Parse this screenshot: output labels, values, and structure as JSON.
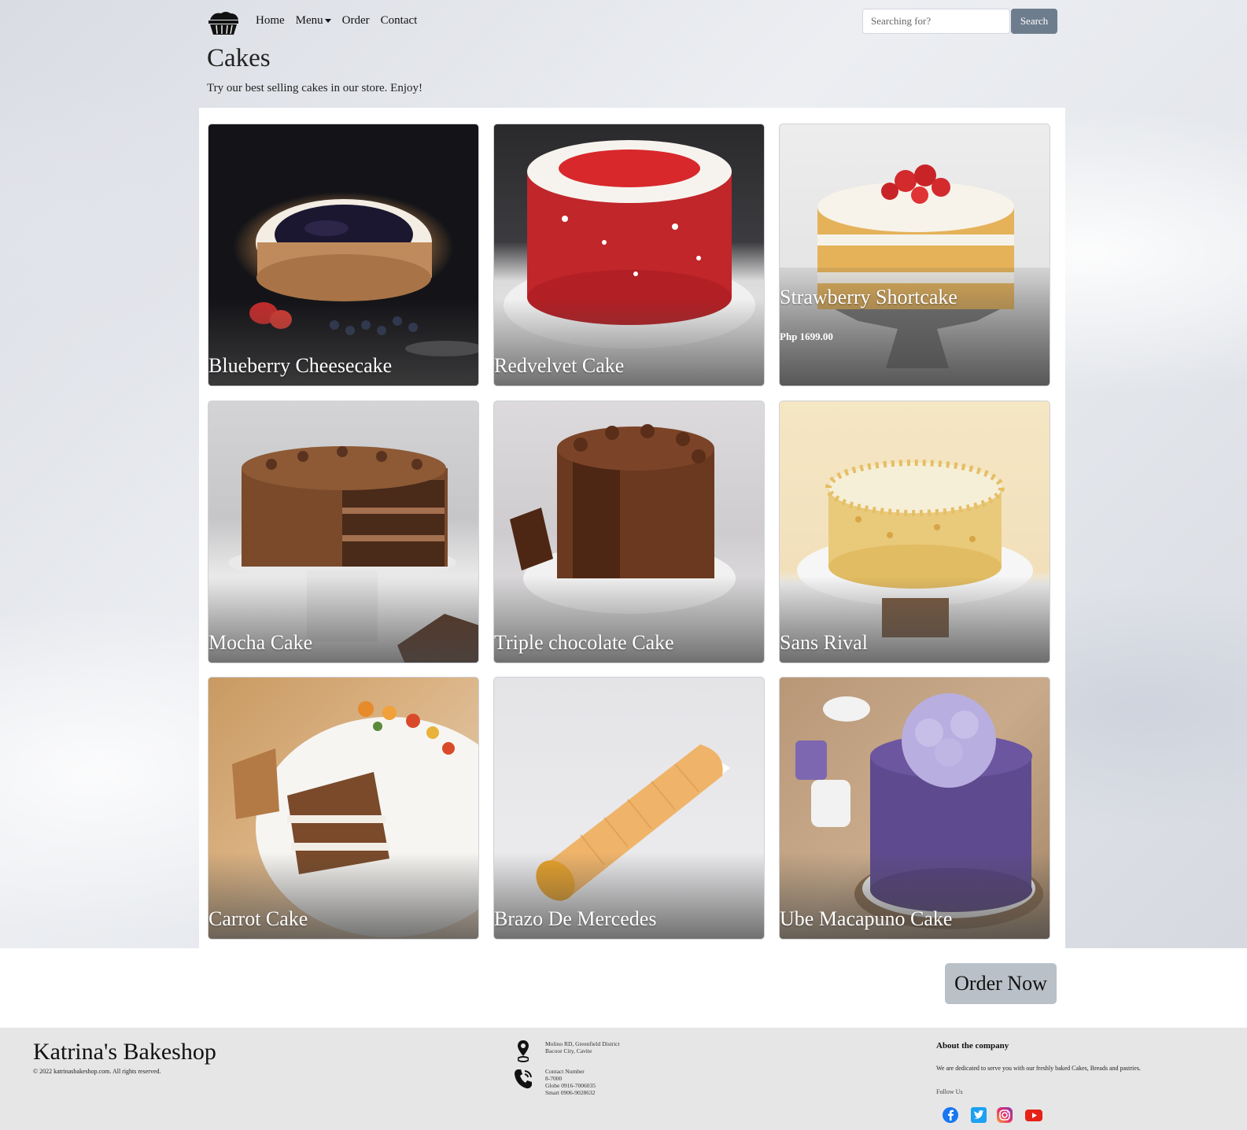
{
  "nav": {
    "logo_icon": "cake-icon",
    "links": [
      "Home",
      "Menu",
      "Order",
      "Contact"
    ],
    "search_placeholder": "Searching for?",
    "search_button": "Search"
  },
  "header": {
    "title": "Cakes",
    "subtitle": "Try our best selling cakes in our store. Enjoy!"
  },
  "products": [
    {
      "name": "Blueberry Cheesecake"
    },
    {
      "name": "Redvelvet Cake"
    },
    {
      "name": "Strawberry Shortcake",
      "price": "Php 1699.00"
    },
    {
      "name": "Mocha Cake"
    },
    {
      "name": "Triple chocolate Cake"
    },
    {
      "name": "Sans Rival"
    },
    {
      "name": "Carrot Cake"
    },
    {
      "name": "Brazo De Mercedes"
    },
    {
      "name": "Ube Macapuno Cake"
    }
  ],
  "order_button": "Order Now",
  "footer": {
    "brand": "Katrina's Bakeshop",
    "copyright": "© 2022 katrinasbakeshop.com. All rights reserved.",
    "address_line1": "Molino RD, Greenfield District",
    "address_line2": "Bacoor City, Cavite",
    "contact_label": "Contact Number",
    "contact_1": "8-7000",
    "contact_2": "Globe 0916-7006035",
    "contact_3": "Smart 0906-9028632",
    "about_title": "About the company",
    "about_text": "We are dedicated to serve you with our freshly baked Cakes, Breads and pastries.",
    "follow_label": "Follow Us",
    "social_icons": [
      "facebook-icon",
      "twitter-icon",
      "instagram-icon",
      "youtube-icon"
    ]
  }
}
